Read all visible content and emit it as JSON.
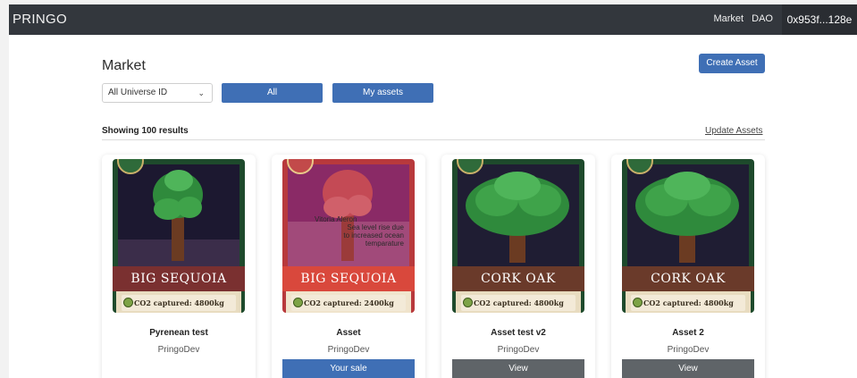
{
  "navbar": {
    "brand": "PRINGO",
    "links": [
      "Market",
      "DAO"
    ],
    "wallet": "0x953f...128e"
  },
  "header": {
    "title": "Market",
    "create_label": "Create Asset"
  },
  "filters": {
    "universe_select": "All Universe ID",
    "all_label": "All",
    "my_assets_label": "My assets"
  },
  "results": {
    "count_text": "Showing 100 results",
    "update_label": "Update Assets"
  },
  "cards": [
    {
      "name": "Pyrenean test",
      "creator": "PringoDev",
      "banner": "BIG SEQUOIA",
      "co2": "CO2 captured: 4800kg",
      "action": ""
    },
    {
      "name": "Asset",
      "creator": "PringoDev",
      "banner": "BIG SEQUOIA",
      "co2": "CO2 captured: 2400kg",
      "action": "Your sale",
      "overlay": [
        "Vitoria Aleron",
        "Sea level rise due",
        "to increased ocean",
        "temparature"
      ]
    },
    {
      "name": "Asset test v2",
      "creator": "PringoDev",
      "banner": "CORK OAK",
      "co2": "CO2 captured: 4800kg",
      "action": "View"
    },
    {
      "name": "Asset 2",
      "creator": "PringoDev",
      "banner": "CORK OAK",
      "co2": "CO2 captured: 4800kg",
      "action": "View"
    }
  ],
  "colors": {
    "navbar": "#33373d",
    "accent": "#3f6fb5",
    "view_button": "#5f6468",
    "card_green": "#1f4d2e",
    "card_red": "#b8393c"
  }
}
